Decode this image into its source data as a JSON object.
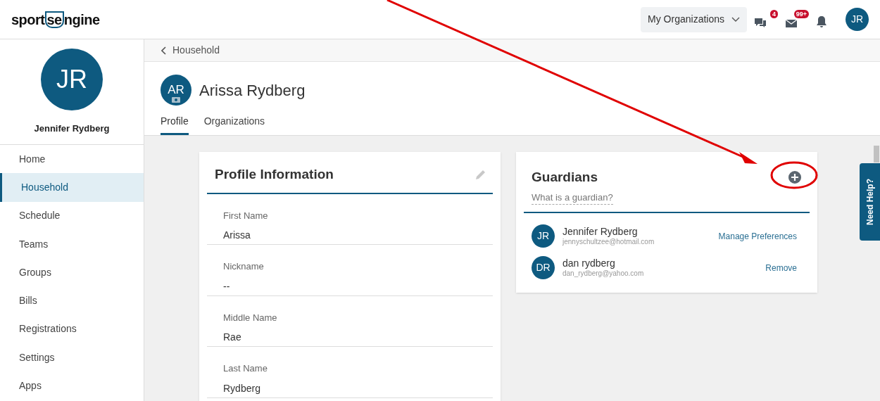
{
  "logo": {
    "text_left": "sport",
    "text_mid": "se",
    "text_right": "ngine"
  },
  "header": {
    "org_menu": "My Organizations",
    "badges": [
      {
        "kind": "chat",
        "count": "4"
      },
      {
        "kind": "mail",
        "count": "99+"
      },
      {
        "kind": "bell"
      }
    ],
    "avatar": "JR"
  },
  "sidebar": {
    "avatar": "JR",
    "name": "Jennifer Rydberg",
    "items": [
      {
        "label": "Home",
        "selected": false
      },
      {
        "label": "Household",
        "selected": true
      },
      {
        "label": "Schedule",
        "selected": false
      },
      {
        "label": "Teams",
        "selected": false
      },
      {
        "label": "Groups",
        "selected": false
      },
      {
        "label": "Bills",
        "selected": false
      },
      {
        "label": "Registrations",
        "selected": false
      },
      {
        "label": "Settings",
        "selected": false
      },
      {
        "label": "Apps",
        "selected": false
      }
    ]
  },
  "breadcrumb": "Household",
  "person": {
    "avatar": "AR",
    "name": "Arissa Rydberg"
  },
  "tabs": [
    {
      "label": "Profile",
      "selected": true
    },
    {
      "label": "Organizations",
      "selected": false
    }
  ],
  "profile_card": {
    "title": "Profile Information",
    "fields": [
      {
        "label": "First Name",
        "value": "Arissa"
      },
      {
        "label": "Nickname",
        "value": "--"
      },
      {
        "label": "Middle Name",
        "value": "Rae"
      },
      {
        "label": "Last Name",
        "value": "Rydberg"
      }
    ]
  },
  "guardians_card": {
    "title": "Guardians",
    "help_link": "What is a guardian?",
    "guardians": [
      {
        "initials": "JR",
        "name": "Jennifer Rydberg",
        "email": "jennyschultzee@hotmail.com",
        "action": "Manage Preferences"
      },
      {
        "initials": "DR",
        "name": "dan rydberg",
        "email": "dan_rydberg@yahoo.com",
        "action": "Remove"
      }
    ]
  },
  "help_tab": "Need Help?"
}
